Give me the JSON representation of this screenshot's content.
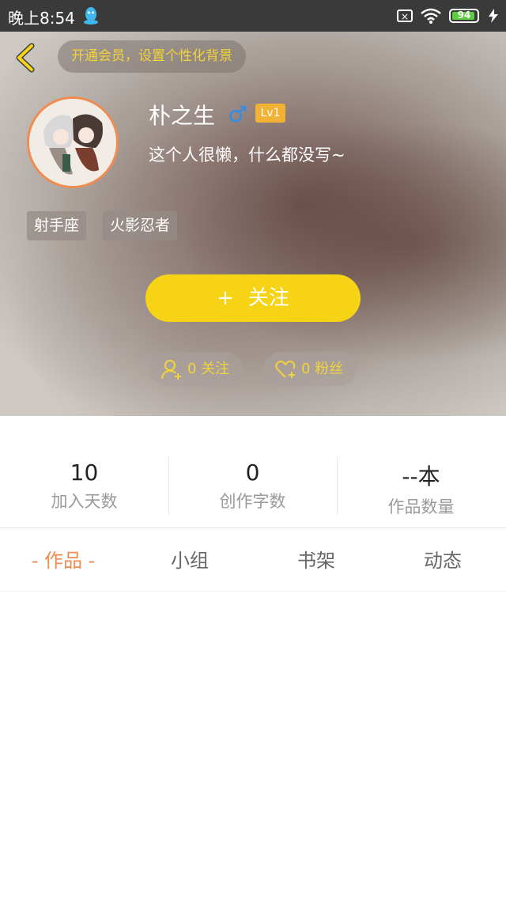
{
  "status_bar": {
    "time": "晚上8:54",
    "battery": "94",
    "battery_level": 0.94
  },
  "header": {
    "vip_banner": "开通会员，设置个性化背景"
  },
  "profile": {
    "name": "朴之生",
    "gender_icon": "♂",
    "level": "Lv1",
    "bio": "这个人很懒，什么都没写~",
    "tags": [
      "射手座",
      "火影忍者"
    ]
  },
  "actions": {
    "follow_plus": "+",
    "follow_label": "关注",
    "following": "0 关注",
    "fans": "0 粉丝"
  },
  "stats": [
    {
      "value": "10",
      "label": "加入天数"
    },
    {
      "value": "0",
      "label": "创作字数"
    },
    {
      "value": "--本",
      "label": "作品数量"
    }
  ],
  "tabs": [
    "- 作品 -",
    "小组",
    "书架",
    "动态"
  ],
  "colors": {
    "accent_orange": "#f28b50",
    "follow_yellow": "#f6d314",
    "vip_text": "#f3d33a",
    "gender_blue": "#2f8ee8",
    "level_badge": "#f2b233"
  },
  "icons": [
    "qq-icon",
    "sim-icon",
    "wifi-icon",
    "battery-icon",
    "charging-icon",
    "back-arrow-icon",
    "gender-male-icon",
    "add-user-icon",
    "heart-plus-icon"
  ]
}
